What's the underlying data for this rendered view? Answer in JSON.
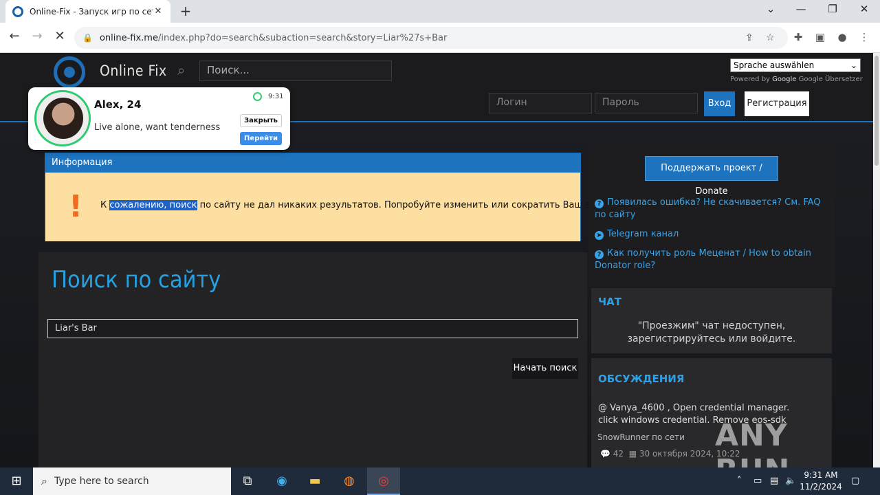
{
  "browser": {
    "tab_title": "Online-Fix - Запуск игр по сети",
    "tab_close": "✕",
    "new_tab": "+",
    "url_domain": "online-fix.me",
    "url_rest": "/index.php?do=search&subaction=search&story=Liar%27s+Bar",
    "window_controls": [
      "⌄",
      "—",
      "❐",
      "✕"
    ]
  },
  "header": {
    "brand": "Online Fix",
    "search_placeholder": "Поиск...",
    "translate_select": "Sprache auswählen",
    "powered_by": "Powered by",
    "google": "Google",
    "translate_brand": "Google Übersetzer",
    "login_placeholder": "Логин",
    "password_placeholder": "Пароль",
    "enter_button": "Вход",
    "register_button": "Регистрация"
  },
  "notification": {
    "name": "Alex, 24",
    "message": "Live alone, want tenderness",
    "time": "9:31",
    "close_button": "Закрыть",
    "go_button": "Перейти"
  },
  "info": {
    "title": "Информация",
    "text_before": "К ",
    "text_highlight": "сожалению, поиск",
    "text_after": " по сайту не дал никаких результатов. Попробуйте изменить или сократить Ваш запрос."
  },
  "search": {
    "title": "Поиск по сайту",
    "value": "Liar's Bar",
    "button": "Начать поиск"
  },
  "sidebar": {
    "donate": "Поддержать проект / Donate",
    "links": [
      "Появилась ошибка? Не скачивается? См. FAQ по сайту",
      "Telegram канал",
      "Как получить роль Меценат / How to obtain Donator role?"
    ],
    "chat_title": "ЧАТ",
    "chat_line1": "\"Проезжим\" чат недоступен,",
    "chat_line2": "зарегистрируйтесь или войдите.",
    "discussions_title": "ОБСУЖДЕНИЯ",
    "discussion_text": "@ Vanya_4600 , Open credential manager. click windows credential. Remove eos-sdk",
    "discussion_game": "SnowRunner по сети",
    "discussion_comments": "42",
    "discussion_date": "30 октября 2024, 10:22"
  },
  "watermark": "ANY RUN",
  "taskbar": {
    "search_placeholder": "Type here to search",
    "time": "9:31 AM",
    "date": "11/2/2024"
  }
}
